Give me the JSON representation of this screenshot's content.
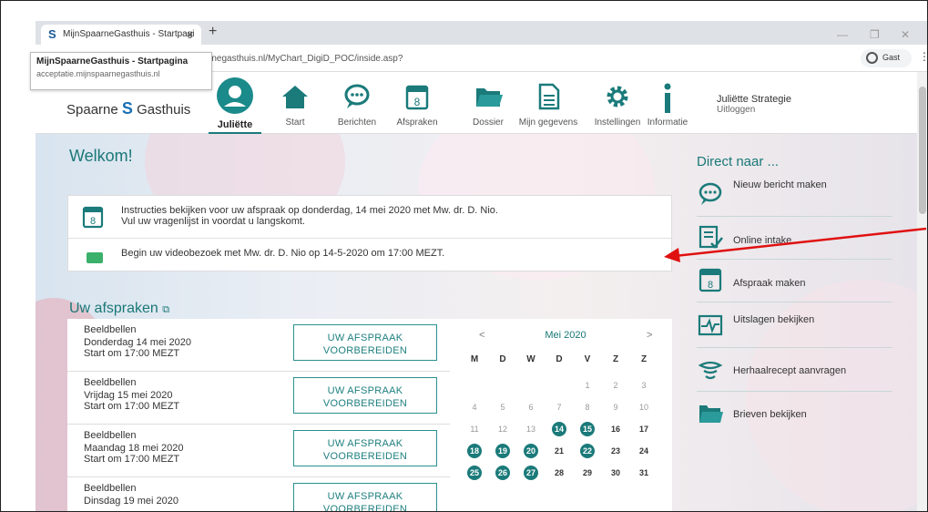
{
  "browser": {
    "tab_title": "MijnSpaarneGasthuis - Startpagi",
    "favicon": "S",
    "close": "×",
    "new_tab": "+",
    "url": "rnegasthuis.nl/MyChart_DigiD_POC/inside.asp?",
    "profile": "Gast",
    "tooltip_title": "MijnSpaarneGasthuis - Startpagina",
    "tooltip_sub": "acceptatie.mijnspaarnegasthuis.nl"
  },
  "site": {
    "logo_part1": "Spaarne",
    "logo_s": "S",
    "logo_part2": "Gasthuis",
    "nav": [
      {
        "label": "Juliëtte",
        "icon": "user-avatar-icon"
      },
      {
        "label": "Start",
        "icon": "home-icon"
      },
      {
        "label": "Berichten",
        "icon": "message-icon"
      },
      {
        "label": "Afspraken",
        "icon": "calendar-icon"
      },
      {
        "label": "Dossier",
        "icon": "folder-icon"
      },
      {
        "label": "Mijn gegevens",
        "icon": "document-icon"
      },
      {
        "label": "Instellingen",
        "icon": "gear-icon"
      },
      {
        "label": "Informatie",
        "icon": "info-icon"
      }
    ],
    "user_name": "Juliëtte Strategie",
    "logout": "Uitloggen"
  },
  "main": {
    "welcome": "Welkom!",
    "notice1_line1": "Instructies bekijken voor uw afspraak op donderdag, 14 mei 2020 met Mw. dr. D. Nio.",
    "notice1_line2": "Vul uw vragenlijst in voordat u langskomt.",
    "notice2": "Begin uw videobezoek met Mw. dr. D. Nio op 14-5-2020 om 17:00 MEZT.",
    "appointments_title": "Uw afspraken",
    "appointments": [
      {
        "type": "Beeldbellen",
        "date": "Donderdag 14 mei 2020",
        "time": "Start om 17:00 MEZT",
        "btn1": "UW AFSPRAAK",
        "btn2": "VOORBEREIDEN"
      },
      {
        "type": "Beeldbellen",
        "date": "Vrijdag 15 mei 2020",
        "time": "Start om 17:00 MEZT",
        "btn1": "UW AFSPRAAK",
        "btn2": "VOORBEREIDEN"
      },
      {
        "type": "Beeldbellen",
        "date": "Maandag 18 mei 2020",
        "time": "Start om 17:00 MEZT",
        "btn1": "UW AFSPRAAK",
        "btn2": "VOORBEREIDEN"
      },
      {
        "type": "Beeldbellen",
        "date": "Dinsdag 19 mei 2020",
        "time": "",
        "btn1": "UW AFSPRAAK",
        "btn2": "VOORBEREIDEN"
      }
    ],
    "calendar": {
      "prev": "<",
      "month": "Mei 2020",
      "next": ">",
      "weekdays": [
        "M",
        "D",
        "W",
        "D",
        "V",
        "Z",
        "Z"
      ],
      "weeks": [
        [
          "",
          "",
          "",
          "",
          "1",
          "2",
          "3"
        ],
        [
          "4",
          "5",
          "6",
          "7",
          "8",
          "9",
          "10"
        ],
        [
          "11",
          "12",
          "13",
          "14",
          "15",
          "16",
          "17"
        ],
        [
          "18",
          "19",
          "20",
          "21",
          "22",
          "23",
          "24"
        ],
        [
          "25",
          "26",
          "27",
          "28",
          "29",
          "30",
          "31"
        ]
      ],
      "appointment_days": [
        "14",
        "15",
        "18",
        "19",
        "20",
        "22",
        "25",
        "26",
        "27"
      ]
    }
  },
  "sidebar": {
    "title": "Direct naar ...",
    "items": [
      {
        "label": "Nieuw bericht maken",
        "icon": "message-icon"
      },
      {
        "label": "Online intake",
        "icon": "checklist-icon"
      },
      {
        "label": "Afspraak maken",
        "icon": "calendar-icon"
      },
      {
        "label": "Uitslagen bekijken",
        "icon": "heartbeat-icon"
      },
      {
        "label": "Herhaalrecept aanvragen",
        "icon": "prescription-icon"
      },
      {
        "label": "Brieven bekijken",
        "icon": "folder-icon"
      }
    ]
  },
  "colors": {
    "teal": "#1b7a7a",
    "annotation_arrow": "#e01010"
  }
}
